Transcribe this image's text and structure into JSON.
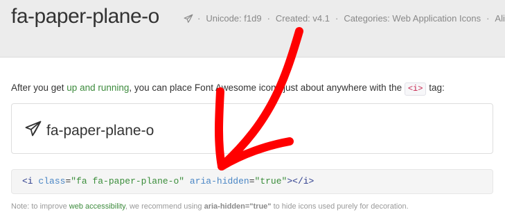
{
  "header": {
    "title": "fa-paper-plane-o",
    "meta": {
      "icon": "paper-plane-o-icon",
      "unicode": "Unicode: f1d9",
      "created": "Created: v4.1",
      "categories": "Categories: Web Application Icons",
      "aliases": "Aliase",
      "separator": "·"
    }
  },
  "intro": {
    "before_link": "After you get ",
    "link": "up and running",
    "middle": ", you can place Font Awesome icons just about anywhere with the ",
    "code": "<i>",
    "after": " tag:"
  },
  "example": {
    "icon": "paper-plane-o-icon",
    "label": "fa-paper-plane-o"
  },
  "code_snippet": {
    "open_tag": "<i",
    "attr_class": "class",
    "val_class": "\"fa fa-paper-plane-o\"",
    "attr_aria": "aria-hidden",
    "val_aria": "\"true\"",
    "close": "></i>",
    "equals": "="
  },
  "note": {
    "before_link": "Note: to improve ",
    "link": "web accessibility",
    "middle": ", we recommend using ",
    "bold": "aria-hidden=\"true\"",
    "after": " to hide icons used purely for decoration."
  },
  "annotation": {
    "arrow_color": "#ff0000"
  },
  "colors": {
    "link_green": "#3d8b3d",
    "header_bg": "#ececec",
    "code_red": "#c7254e"
  }
}
